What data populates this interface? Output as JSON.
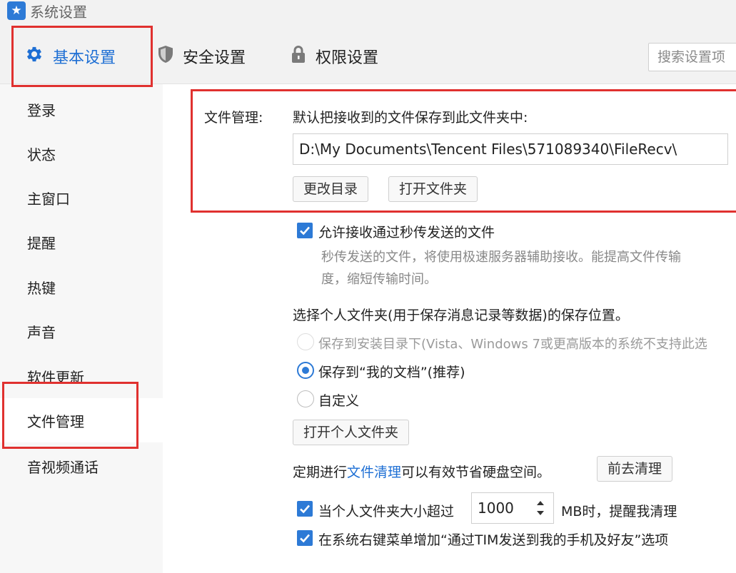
{
  "window": {
    "title": "系统设置",
    "logo_icon": "star-icon",
    "accent": "#2d7ad6",
    "highlight": "#e0312f"
  },
  "tabs": [
    {
      "label": "基本设置",
      "icon": "gear-icon",
      "active": true
    },
    {
      "label": "安全设置",
      "icon": "shield-icon",
      "active": false
    },
    {
      "label": "权限设置",
      "icon": "lock-icon",
      "active": false
    }
  ],
  "search": {
    "placeholder": "搜索设置项"
  },
  "sidebar": {
    "items": [
      {
        "label": "登录"
      },
      {
        "label": "状态"
      },
      {
        "label": "主窗口"
      },
      {
        "label": "提醒"
      },
      {
        "label": "热键"
      },
      {
        "label": "声音"
      },
      {
        "label": "软件更新"
      },
      {
        "label": "文件管理",
        "active": true
      },
      {
        "label": "音视频通话"
      }
    ]
  },
  "file_management": {
    "section_label": "文件管理:",
    "default_folder_label": "默认把接收到的文件保存到此文件夹中:",
    "path_value": "D:\\My Documents\\Tencent Files\\571089340\\FileRecv\\",
    "change_dir_button": "更改目录",
    "open_folder_button": "打开文件夹",
    "instant_transfer": {
      "checked": true,
      "label": "允许接收通过秒传发送的文件",
      "desc_line1": "秒传发送的文件，将使用极速服务器辅助接收。能提高文件传输",
      "desc_line2": "度，缩短传输时间。"
    },
    "personal_folder": {
      "heading": "选择个人文件夹(用于保存消息记录等数据)的保存位置。",
      "options": [
        {
          "label": "保存到安装目录下(Vista、Windows 7或更高版本的系统不支持此选",
          "disabled": true,
          "checked": false
        },
        {
          "label": "保存到“我的文档”(推荐)",
          "disabled": false,
          "checked": true
        },
        {
          "label": "自定义",
          "disabled": false,
          "checked": false
        }
      ],
      "open_personal_button": "打开个人文件夹"
    },
    "cleanup": {
      "text_before": "定期进行",
      "link": "文件清理",
      "text_after": "可以有效节省硬盘空间。",
      "button": "前去清理"
    },
    "size_alert": {
      "checked": true,
      "label": "当个人文件夹大小超过",
      "value": "1000",
      "unit_text": "MB时，提醒我清理"
    },
    "context_menu": {
      "checked": true,
      "label": "在系统右键菜单增加“通过TIM发送到我的手机及好友”选项"
    }
  }
}
